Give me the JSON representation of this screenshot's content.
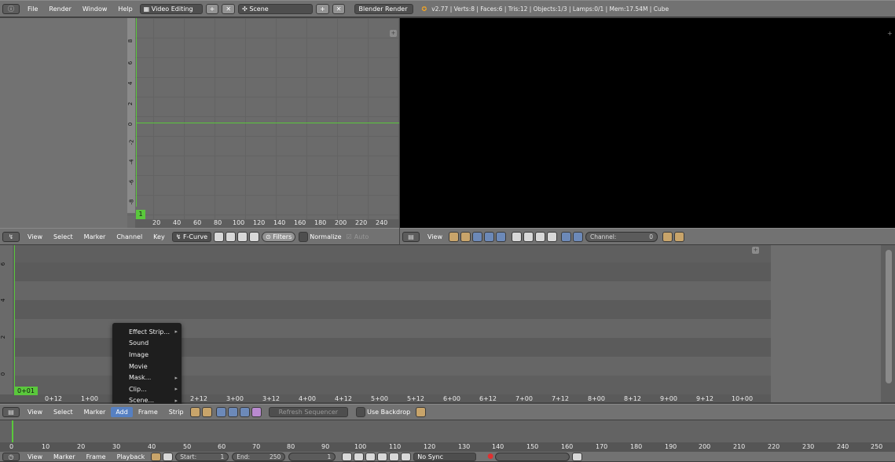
{
  "top_bar": {
    "menu": [
      "File",
      "Render",
      "Window",
      "Help"
    ],
    "screen_layout": "Video Editing",
    "scene": "Scene",
    "engine": "Blender Render",
    "stats": "v2.77 | Verts:8 | Faces:6 | Tris:12 | Objects:1/3 | Lamps:0/1 | Mem:17.54M | Cube"
  },
  "graph_editor": {
    "y_ticks": [
      "8",
      "6",
      "4",
      "2",
      "0",
      "-2",
      "-4",
      "-6",
      "-8"
    ],
    "x_ticks": [
      "20",
      "40",
      "60",
      "80",
      "100",
      "120",
      "140",
      "160",
      "180",
      "200",
      "220",
      "240"
    ],
    "current_frame": "1",
    "header": {
      "menu": [
        "View",
        "Select",
        "Marker",
        "Channel",
        "Key"
      ],
      "mode": "F-Curve",
      "filters": "Filters",
      "normalize": "Normalize",
      "auto": "Auto"
    }
  },
  "preview_header": {
    "menu": [
      "View"
    ],
    "channel_label": "Channel:",
    "channel_value": "0"
  },
  "sequencer": {
    "y_ticks": [
      "6",
      "4",
      "2",
      "0"
    ],
    "x_ticks": [
      "0+12",
      "1+00",
      "2+12",
      "3+00",
      "3+12",
      "4+00",
      "4+12",
      "5+00",
      "5+12",
      "6+00",
      "6+12",
      "7+00",
      "7+12",
      "8+00",
      "8+12",
      "9+00",
      "9+12",
      "10+00"
    ],
    "current_frame": "0+01",
    "header": {
      "menu": [
        "View",
        "Select",
        "Marker",
        "Add",
        "Frame",
        "Strip"
      ],
      "refresh": "Refresh Sequencer",
      "use_backdrop": "Use Backdrop"
    },
    "add_menu": [
      {
        "label": "Effect Strip...",
        "submenu": true
      },
      {
        "label": "Sound",
        "submenu": false
      },
      {
        "label": "Image",
        "submenu": false
      },
      {
        "label": "Movie",
        "submenu": false
      },
      {
        "label": "Mask...",
        "submenu": true
      },
      {
        "label": "Clip...",
        "submenu": true
      },
      {
        "label": "Scene...",
        "submenu": true
      }
    ]
  },
  "timeline": {
    "ticks": [
      "0",
      "10",
      "20",
      "30",
      "40",
      "50",
      "60",
      "70",
      "80",
      "90",
      "100",
      "110",
      "120",
      "130",
      "140",
      "150",
      "160",
      "170",
      "180",
      "190",
      "200",
      "210",
      "220",
      "230",
      "240",
      "250"
    ],
    "header": {
      "menu": [
        "View",
        "Marker",
        "Frame",
        "Playback"
      ],
      "start_label": "Start:",
      "start_value": "1",
      "end_label": "End:",
      "end_value": "250",
      "current": "1",
      "sync": "No Sync"
    }
  }
}
